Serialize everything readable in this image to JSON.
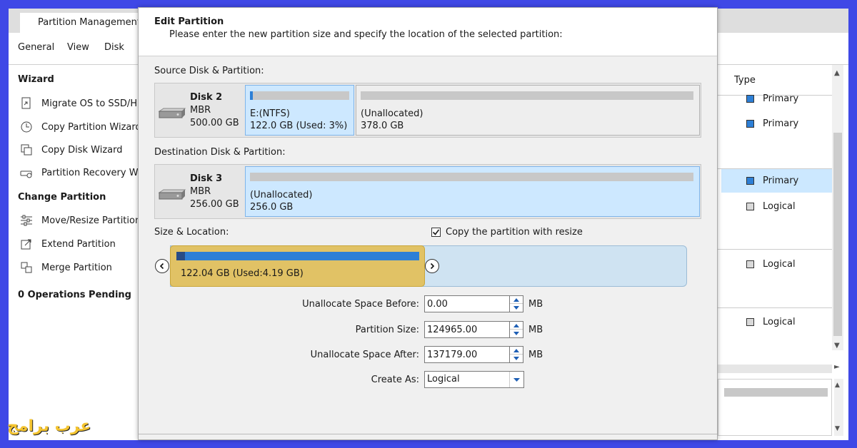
{
  "app": {
    "tab": "Partition Management",
    "menu": [
      "General",
      "View",
      "Disk"
    ],
    "sidebar": {
      "wizard_heading": "Wizard",
      "wizard_items": [
        "Migrate OS to SSD/HD",
        "Copy Partition Wizard",
        "Copy Disk Wizard",
        "Partition Recovery Wiz"
      ],
      "change_heading": "Change Partition",
      "change_items": [
        "Move/Resize Partition",
        "Extend Partition",
        "Merge Partition"
      ],
      "pending": "0 Operations Pending"
    },
    "right_panel": {
      "header": "Type",
      "rows": [
        "Primary",
        "Primary",
        "Primary",
        "Logical",
        "Logical",
        "Logical"
      ],
      "colors": {
        "primary": "#2d7fd6",
        "logical": "#d9d9d9"
      }
    }
  },
  "dialog": {
    "title": "Edit Partition",
    "subtitle": "Please enter the new partition size and specify the location of the selected partition:",
    "source": {
      "label": "Source Disk & Partition:",
      "disk_name": "Disk 2",
      "disk_type": "MBR",
      "disk_size": "500.00 GB",
      "partitions": [
        {
          "name": "E:(NTFS)",
          "size": "122.0 GB (Used: 3%)",
          "used_pct": 3,
          "selected": true
        },
        {
          "name": "(Unallocated)",
          "size": "378.0 GB",
          "used_pct": 0,
          "selected": false
        }
      ]
    },
    "destination": {
      "label": "Destination Disk & Partition:",
      "disk_name": "Disk 3",
      "disk_type": "MBR",
      "disk_size": "256.00 GB",
      "partitions": [
        {
          "name": "(Unallocated)",
          "size": "256.0 GB",
          "selected": true
        }
      ]
    },
    "size_location": {
      "label": "Size & Location:",
      "copy_resize_label": "Copy the partition with resize",
      "copy_resize_checked": true,
      "slider_label": "122.04 GB (Used:4.19 GB)"
    },
    "fields": {
      "before_label": "Unallocate Space Before:",
      "before_value": "0.00",
      "size_label": "Partition Size:",
      "size_value": "124965.00",
      "after_label": "Unallocate Space After:",
      "after_value": "137179.00",
      "unit": "MB",
      "create_as_label": "Create As:",
      "create_as_value": "Logical"
    }
  },
  "watermark": "عرب برامج",
  "colors": {
    "background": "#3f48e6",
    "selection": "#cde8ff",
    "used_bar": "#2d7fd6",
    "slider_block": "#e1c265",
    "slider_track": "#cfe3f2"
  }
}
